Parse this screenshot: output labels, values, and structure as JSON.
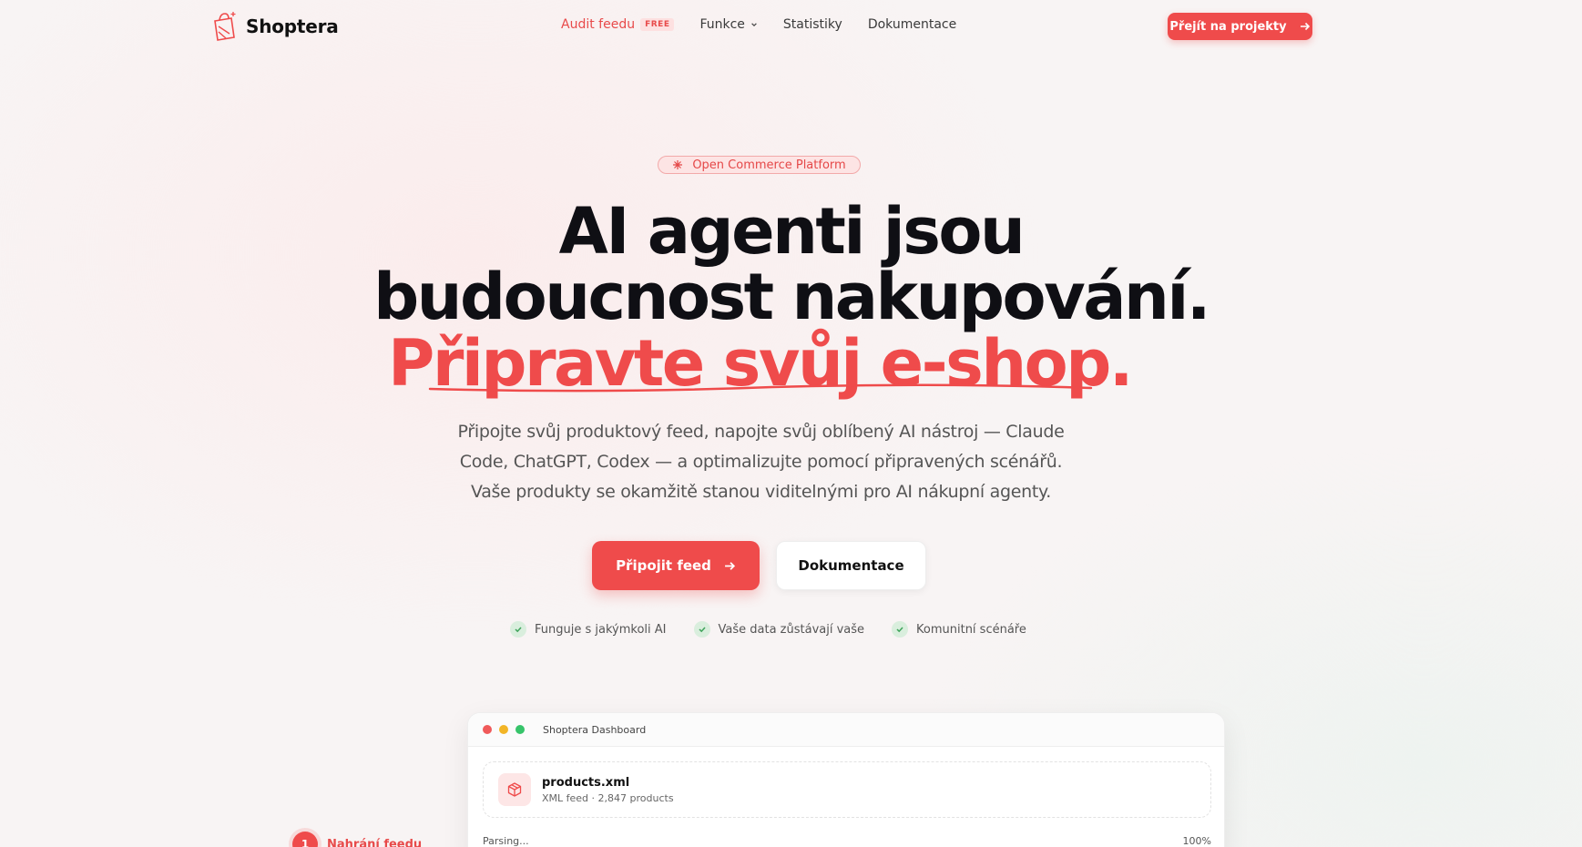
{
  "brand": {
    "name": "Shoptera",
    "logo_icon": "shopping-bag-icon"
  },
  "nav": {
    "items": [
      {
        "label": "Audit feedu",
        "badge": "FREE"
      },
      {
        "label": "Funkce"
      },
      {
        "label": "Statistiky"
      },
      {
        "label": "Dokumentace"
      }
    ],
    "cta_label": "Přejít na projekty"
  },
  "hero": {
    "pill_label": "Open Commerce Platform",
    "title_line1": "AI agenti jsou",
    "title_line2": "budoucnost nakupování.",
    "title_accent": "Připravte svůj e-shop.",
    "lead_line1": "Připojte svůj produktový feed, napojte svůj oblíbený AI nástroj — Claude",
    "lead_line2": "Code, ChatGPT, Codex — a optimalizujte pomocí připravených scénářů.",
    "lead_line3": "Vaše produkty se okamžitě stanou viditelnými pro AI nákupní agenty.",
    "primary_button": "Připojit feed",
    "secondary_button": "Dokumentace",
    "checks": [
      "Funguje s jakýmkoli AI",
      "Vaše data zůstávají vaše",
      "Komunitní scénáře"
    ]
  },
  "dashboard": {
    "window_title": "Shoptera Dashboard",
    "file_name": "products.xml",
    "file_meta": "XML feed · 2,847 products",
    "status_label": "Parsing...",
    "progress_label": "100%"
  },
  "steps": [
    {
      "number": "1",
      "label": "Nahrání feedu"
    }
  ],
  "colors": {
    "accent": "#ef4b4b",
    "text": "#0f0f14",
    "muted": "#555555"
  }
}
